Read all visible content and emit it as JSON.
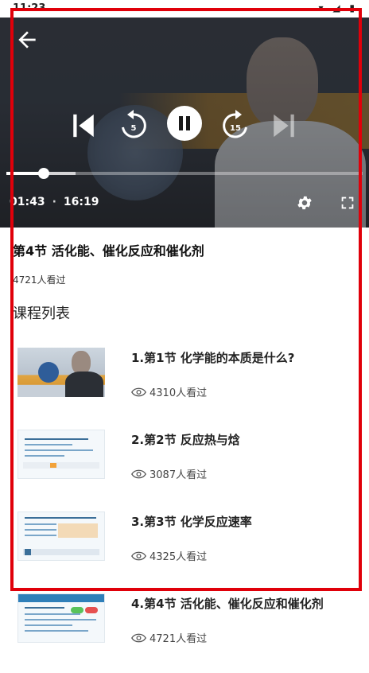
{
  "status_bar": {
    "time": "11:23"
  },
  "player": {
    "current_time": "01:43",
    "duration": "16:19",
    "time_separator": "·",
    "progress_fraction": 0.105,
    "buffer_fraction": 0.195,
    "rewind_seconds": "5",
    "forward_seconds": "15"
  },
  "lesson": {
    "title": "第4节 活化能、催化反应和催化剂",
    "views": "4721人看过"
  },
  "course_list": {
    "heading": "课程列表",
    "items": [
      {
        "title": "1.第1节 化学能的本质是什么?",
        "views": "4310人看过"
      },
      {
        "title": "2.第2节 反应热与焓",
        "views": "3087人看过"
      },
      {
        "title": "3.第3节 化学反应速率",
        "views": "4325人看过"
      },
      {
        "title": "4.第4节 活化能、催化反应和催化剂",
        "views": "4721人看过"
      }
    ]
  },
  "colors": {
    "highlight_border": "#e0000a",
    "player_background": "#3a3f47"
  },
  "icons": {
    "back": "arrow-left-icon",
    "previous": "skip-previous-icon",
    "rewind": "replay-5-icon",
    "pause": "pause-icon",
    "forward": "forward-15-icon",
    "next": "skip-next-icon",
    "settings": "gear-icon",
    "fullscreen": "fullscreen-icon",
    "views": "eye-icon"
  }
}
